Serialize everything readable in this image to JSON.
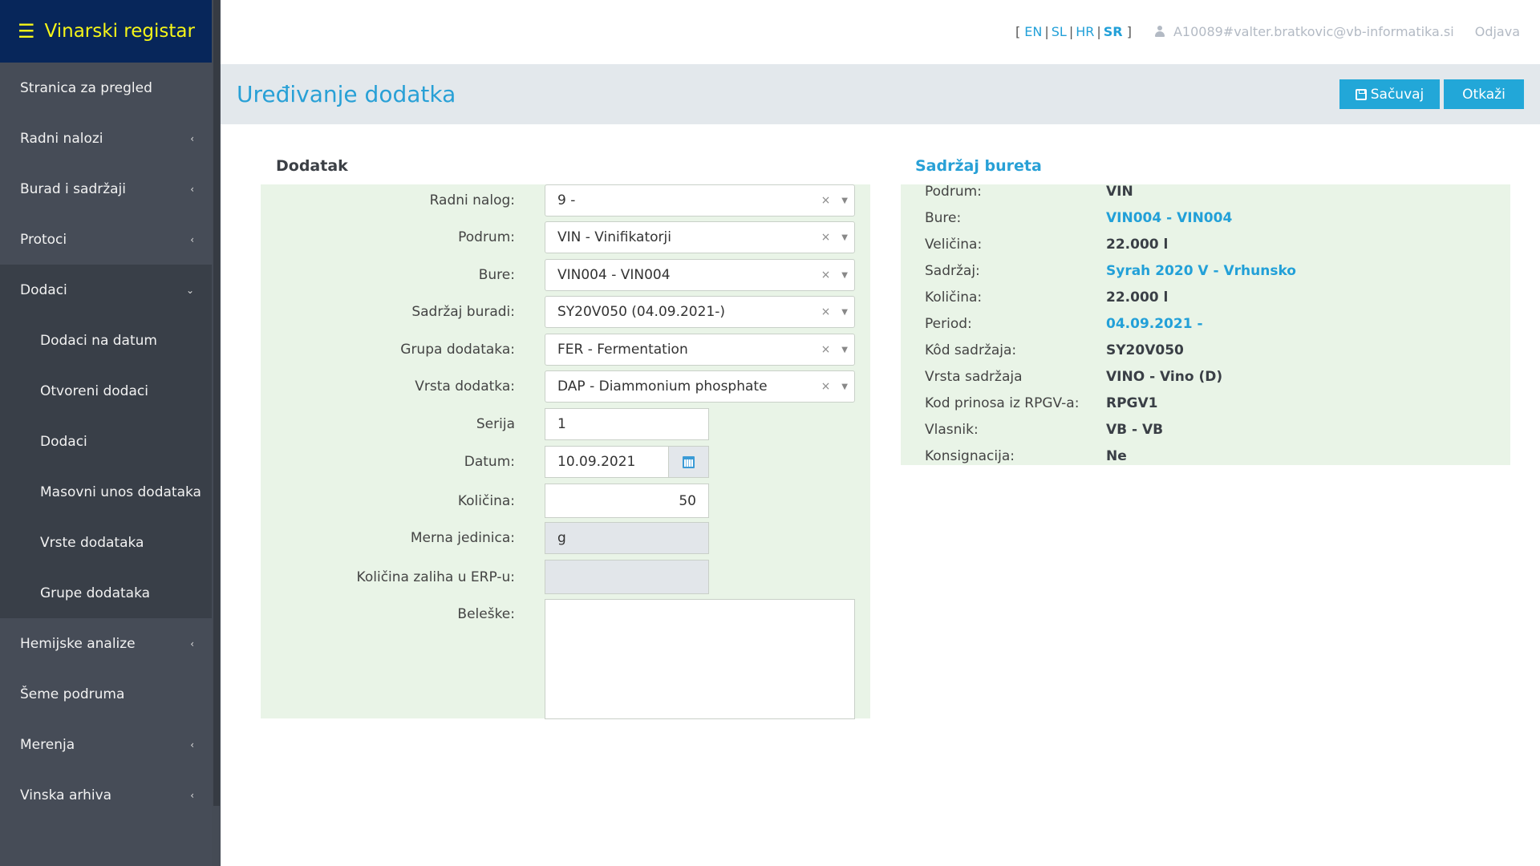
{
  "app": {
    "title": "Vinarski registar",
    "menu_icon": "hamburger-icon"
  },
  "sidebar": {
    "items": [
      {
        "label": "Stranica za pregled",
        "chevron": ""
      },
      {
        "label": "Radni nalozi",
        "chevron": "‹"
      },
      {
        "label": "Burad i sadržaji",
        "chevron": "‹"
      },
      {
        "label": "Protoci",
        "chevron": "‹"
      },
      {
        "label": "Dodaci",
        "chevron": "⌄"
      },
      {
        "label": "Hemijske analize",
        "chevron": "‹"
      },
      {
        "label": "Šeme podruma",
        "chevron": ""
      },
      {
        "label": "Merenja",
        "chevron": "‹"
      },
      {
        "label": "Vinska arhiva",
        "chevron": "‹"
      }
    ],
    "dodaci_sub": [
      {
        "label": "Dodaci na datum"
      },
      {
        "label": "Otvoreni dodaci"
      },
      {
        "label": "Dodaci"
      },
      {
        "label": "Masovni unos dodataka"
      },
      {
        "label": "Vrste dodataka"
      },
      {
        "label": "Grupe dodataka"
      }
    ]
  },
  "topbar": {
    "lang_open": "[",
    "lang_close": "]",
    "languages": [
      "EN",
      "SL",
      "HR",
      "SR"
    ],
    "active_language": "SR",
    "user": "A10089#valter.bratkovic@vb-informatika.si",
    "logout": "Odjava"
  },
  "page": {
    "title": "Uređivanje dodatka",
    "save_label": "Sačuvaj",
    "cancel_label": "Otkaži"
  },
  "form": {
    "title": "Dodatak",
    "radni_nalog": {
      "label": "Radni nalog:",
      "value": "9 -"
    },
    "podrum": {
      "label": "Podrum:",
      "value": "VIN - Vinifikatorji"
    },
    "bure": {
      "label": "Bure:",
      "value": "VIN004 - VIN004"
    },
    "sadrzaj_buradi": {
      "label": "Sadržaj buradi:",
      "value": "SY20V050 (04.09.2021-)"
    },
    "grupa": {
      "label": "Grupa dodataka:",
      "value": "FER - Fermentation"
    },
    "vrsta": {
      "label": "Vrsta dodatka:",
      "value": "DAP - Diammonium phosphate"
    },
    "serija": {
      "label": "Serija",
      "value": "1"
    },
    "datum": {
      "label": "Datum:",
      "value": "10.09.2021"
    },
    "kolicina": {
      "label": "Količina:",
      "value": "50"
    },
    "jedinica": {
      "label": "Merna jedinica:",
      "value": "g"
    },
    "zaliha": {
      "label": "Količina zaliha u ERP-u:",
      "value": ""
    },
    "beleske": {
      "label": "Beleške:",
      "value": ""
    },
    "clear_glyph": "×",
    "caret_glyph": "▼"
  },
  "info": {
    "title": "Sadržaj bureta",
    "rows": [
      {
        "label": "Podrum:",
        "value": "VIN"
      },
      {
        "label": "Bure:",
        "value": "VIN004 - VIN004"
      },
      {
        "label": "Veličina:",
        "value": "22.000 l"
      },
      {
        "label": "Sadržaj:",
        "value": "Syrah 2020 V - Vrhunsko"
      },
      {
        "label": "Količina:",
        "value": "22.000 l"
      },
      {
        "label": "Period:",
        "value": "04.09.2021 -"
      },
      {
        "label": "Kôd sadržaja:",
        "value": "SY20V050"
      },
      {
        "label": "Vrsta sadržaja",
        "value": "VINO - Vino (D)"
      },
      {
        "label": "Kod prinosa iz RPGV-a:",
        "value": "RPGV1"
      },
      {
        "label": "Vlasnik:",
        "value": "VB - VB"
      },
      {
        "label": "Konsignacija:",
        "value": "Ne"
      }
    ]
  },
  "colors": {
    "accent": "#22a7d8",
    "brand_bg": "#07265a",
    "brand_text": "#f5f518",
    "panel_bg": "#e9f4e7"
  }
}
